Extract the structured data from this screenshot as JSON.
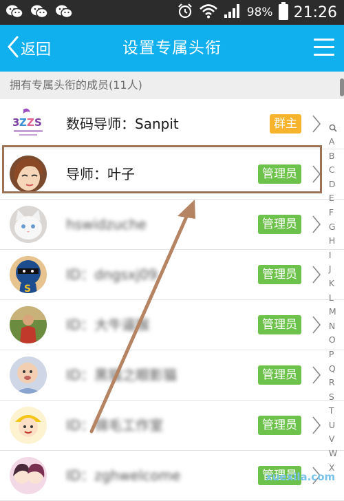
{
  "status_bar": {
    "battery_percent": "98%",
    "time": "21:26",
    "icons": [
      "wechat-icon",
      "wechat-icon",
      "wechat-icon",
      "alarm-icon",
      "wifi-icon",
      "signal-icon",
      "battery-icon"
    ]
  },
  "header": {
    "back_label": "返回",
    "title": "设置专属头衔",
    "menu_icon": "menu-icon"
  },
  "section": {
    "title": "拥有专属头衔的成员(11人)"
  },
  "members": [
    {
      "name": "数码导师：Sanpit",
      "role": "群主",
      "avatar": "3zz-logo-avatar",
      "blurred": false
    },
    {
      "name": "导师：叶子",
      "role": "管理员",
      "avatar": "cartoon-girl-avatar",
      "blurred": false
    },
    {
      "name": "hswidzuche",
      "role": "管理员",
      "avatar": "white-cat-avatar",
      "blurred": true
    },
    {
      "name": "ID：dngsxj09",
      "role": "管理员",
      "avatar": "superhero-avatar",
      "blurred": true
    },
    {
      "name": "ID：大牛逼猴",
      "role": "管理员",
      "avatar": "person-photo-avatar",
      "blurred": true
    },
    {
      "name": "ID：黑猫之眼影猫",
      "role": "管理员",
      "avatar": "baby-photo-avatar",
      "blurred": true
    },
    {
      "name": "ID：锦毛工作室",
      "role": "管理员",
      "avatar": "cartoon-kid-avatar",
      "blurred": true
    },
    {
      "name": "ID：zghwelcome",
      "role": "管理员",
      "avatar": "anime-girls-avatar",
      "blurred": true
    }
  ],
  "index_bar": {
    "letters": [
      "A",
      "B",
      "C",
      "D",
      "E",
      "F",
      "G",
      "H",
      "I",
      "J",
      "K",
      "L",
      "M",
      "N",
      "O",
      "P",
      "Q",
      "R",
      "S",
      "T",
      "U",
      "V",
      "W",
      "X"
    ]
  },
  "watermark": "xuexila.com",
  "colors": {
    "title_bar": "#10b0ee",
    "owner_badge": "#f6b32b",
    "admin_badge": "#6cc24a",
    "highlight_border": "#9b7256",
    "annotation_arrow": "#b48463"
  }
}
